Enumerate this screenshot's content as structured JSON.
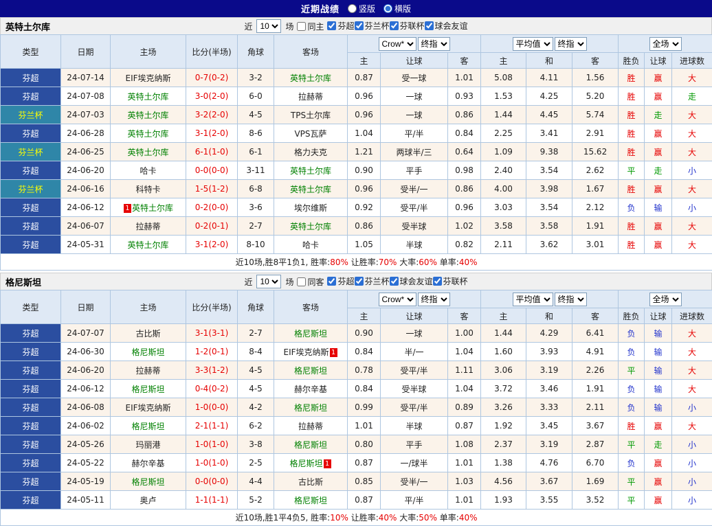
{
  "topbar": {
    "title": "近期战绩",
    "vertical_label": "竖版",
    "horizontal_label": "横版"
  },
  "ui": {
    "near_label": "近",
    "games_label": "场",
    "badge_text": "1",
    "cup_league": "芬兰杯"
  },
  "table": {
    "col_type": "类型",
    "col_date": "日期",
    "col_home": "主场",
    "col_score": "比分(半场)",
    "col_corner": "角球",
    "col_away": "客场",
    "bookmaker_select": "Crow*",
    "final_select_1": "终指",
    "average_select": "平均值",
    "final_select_2": "终指",
    "scope_select": "全场",
    "sub_headers": [
      "主",
      "让球",
      "客",
      "主",
      "和",
      "客",
      "胜负",
      "让球",
      "进球数"
    ]
  },
  "colors": {
    "topbar_bg": "#0a0a8a",
    "header_bg": "#dfe9f5",
    "border": "#aec6e0",
    "row_alt": "#fbf3ea",
    "super_bg": "#2b4ea0",
    "cup_bg": "#2f86a8",
    "cup_text": "#ffff00",
    "focus_team": "#008000",
    "score": "#e60000",
    "win": "#e60000",
    "draw": "#009900",
    "lose": "#2233cc"
  },
  "sections": [
    {
      "team": "英特土尔库",
      "filter": {
        "count": "10",
        "same_label": "同主",
        "leagues": [
          "芬超",
          "芬兰杯",
          "芬联杯",
          "球会友谊"
        ]
      },
      "rows": [
        {
          "lg": "芬超",
          "date": "24-07-14",
          "home": {
            "n": "EIF埃克纳斯"
          },
          "score": "0-7(0-2)",
          "cor": "3-2",
          "away": {
            "n": "英特土尔库",
            "f": 1
          },
          "o": [
            "0.87",
            "受一球",
            "1.01"
          ],
          "e": [
            "5.08",
            "4.11",
            "1.56"
          ],
          "r": [
            "胜",
            "赢",
            "大"
          ]
        },
        {
          "lg": "芬超",
          "date": "24-07-08",
          "home": {
            "n": "英特土尔库",
            "f": 1
          },
          "score": "3-0(2-0)",
          "cor": "6-0",
          "away": {
            "n": "拉赫蒂"
          },
          "o": [
            "0.96",
            "一球",
            "0.93"
          ],
          "e": [
            "1.53",
            "4.25",
            "5.20"
          ],
          "r": [
            "胜",
            "赢",
            "走"
          ]
        },
        {
          "lg": "芬兰杯",
          "date": "24-07-03",
          "home": {
            "n": "英特土尔库",
            "f": 1
          },
          "score": "3-2(2-0)",
          "cor": "4-5",
          "away": {
            "n": "TPS土尔库"
          },
          "o": [
            "0.96",
            "一球",
            "0.86"
          ],
          "e": [
            "1.44",
            "4.45",
            "5.74"
          ],
          "r": [
            "胜",
            "走",
            "大"
          ]
        },
        {
          "lg": "芬超",
          "date": "24-06-28",
          "home": {
            "n": "英特土尔库",
            "f": 1
          },
          "score": "3-1(2-0)",
          "cor": "8-6",
          "away": {
            "n": "VPS瓦萨"
          },
          "o": [
            "1.04",
            "平/半",
            "0.84"
          ],
          "e": [
            "2.25",
            "3.41",
            "2.91"
          ],
          "r": [
            "胜",
            "赢",
            "大"
          ]
        },
        {
          "lg": "芬兰杯",
          "date": "24-06-25",
          "home": {
            "n": "英特土尔库",
            "f": 1
          },
          "score": "6-1(1-0)",
          "cor": "6-1",
          "away": {
            "n": "格力夫克"
          },
          "o": [
            "1.21",
            "两球半/三",
            "0.64"
          ],
          "e": [
            "1.09",
            "9.38",
            "15.62"
          ],
          "r": [
            "胜",
            "赢",
            "大"
          ]
        },
        {
          "lg": "芬超",
          "date": "24-06-20",
          "home": {
            "n": "哈卡"
          },
          "score": "0-0(0-0)",
          "cor": "3-11",
          "away": {
            "n": "英特土尔库",
            "f": 1
          },
          "o": [
            "0.90",
            "平手",
            "0.98"
          ],
          "e": [
            "2.40",
            "3.54",
            "2.62"
          ],
          "r": [
            "平",
            "走",
            "小"
          ]
        },
        {
          "lg": "芬兰杯",
          "date": "24-06-16",
          "home": {
            "n": "科特卡"
          },
          "score": "1-5(1-2)",
          "cor": "6-8",
          "away": {
            "n": "英特土尔库",
            "f": 1
          },
          "o": [
            "0.96",
            "受半/一",
            "0.86"
          ],
          "e": [
            "4.00",
            "3.98",
            "1.67"
          ],
          "r": [
            "胜",
            "赢",
            "大"
          ]
        },
        {
          "lg": "芬超",
          "date": "24-06-12",
          "home": {
            "n": "英特土尔库",
            "f": 1,
            "b": "pre"
          },
          "score": "0-2(0-0)",
          "cor": "3-6",
          "away": {
            "n": "埃尔维斯"
          },
          "o": [
            "0.92",
            "受平/半",
            "0.96"
          ],
          "e": [
            "3.03",
            "3.54",
            "2.12"
          ],
          "r": [
            "负",
            "输",
            "小"
          ]
        },
        {
          "lg": "芬超",
          "date": "24-06-07",
          "home": {
            "n": "拉赫蒂"
          },
          "score": "0-2(0-1)",
          "cor": "2-7",
          "away": {
            "n": "英特土尔库",
            "f": 1
          },
          "o": [
            "0.86",
            "受半球",
            "1.02"
          ],
          "e": [
            "3.58",
            "3.58",
            "1.91"
          ],
          "r": [
            "胜",
            "赢",
            "大"
          ]
        },
        {
          "lg": "芬超",
          "date": "24-05-31",
          "home": {
            "n": "英特土尔库",
            "f": 1
          },
          "score": "3-1(2-0)",
          "cor": "8-10",
          "away": {
            "n": "哈卡"
          },
          "o": [
            "1.05",
            "半球",
            "0.82"
          ],
          "e": [
            "2.11",
            "3.62",
            "3.01"
          ],
          "r": [
            "胜",
            "赢",
            "大"
          ]
        }
      ],
      "footer": [
        {
          "t": "近10场,胜8平1负1,  胜率:"
        },
        {
          "t": "80%",
          "red": 1
        },
        {
          "t": "  让胜率:"
        },
        {
          "t": "70%",
          "red": 1
        },
        {
          "t": "  大率:"
        },
        {
          "t": "60%",
          "red": 1
        },
        {
          "t": "  单率:"
        },
        {
          "t": "40%",
          "red": 1
        }
      ]
    },
    {
      "team": "格尼斯坦",
      "filter": {
        "count": "10",
        "same_label": "同客",
        "leagues": [
          "芬超",
          "芬兰杯",
          "球会友谊",
          "芬联杯"
        ]
      },
      "rows": [
        {
          "lg": "芬超",
          "date": "24-07-07",
          "home": {
            "n": "古比斯"
          },
          "score": "3-1(3-1)",
          "cor": "2-7",
          "away": {
            "n": "格尼斯坦",
            "f": 1
          },
          "o": [
            "0.90",
            "一球",
            "1.00"
          ],
          "e": [
            "1.44",
            "4.29",
            "6.41"
          ],
          "r": [
            "负",
            "输",
            "大"
          ]
        },
        {
          "lg": "芬超",
          "date": "24-06-30",
          "home": {
            "n": "格尼斯坦",
            "f": 1
          },
          "score": "1-2(0-1)",
          "cor": "8-4",
          "away": {
            "n": "EIF埃克纳斯",
            "b": "post"
          },
          "o": [
            "0.84",
            "半/一",
            "1.04"
          ],
          "e": [
            "1.60",
            "3.93",
            "4.91"
          ],
          "r": [
            "负",
            "输",
            "大"
          ]
        },
        {
          "lg": "芬超",
          "date": "24-06-20",
          "home": {
            "n": "拉赫蒂"
          },
          "score": "3-3(1-2)",
          "cor": "4-5",
          "away": {
            "n": "格尼斯坦",
            "f": 1
          },
          "o": [
            "0.78",
            "受平/半",
            "1.11"
          ],
          "e": [
            "3.06",
            "3.19",
            "2.26"
          ],
          "r": [
            "平",
            "输",
            "大"
          ]
        },
        {
          "lg": "芬超",
          "date": "24-06-12",
          "home": {
            "n": "格尼斯坦",
            "f": 1
          },
          "score": "0-4(0-2)",
          "cor": "4-5",
          "away": {
            "n": "赫尔辛基"
          },
          "o": [
            "0.84",
            "受半球",
            "1.04"
          ],
          "e": [
            "3.72",
            "3.46",
            "1.91"
          ],
          "r": [
            "负",
            "输",
            "大"
          ]
        },
        {
          "lg": "芬超",
          "date": "24-06-08",
          "home": {
            "n": "EIF埃克纳斯"
          },
          "score": "1-0(0-0)",
          "cor": "4-2",
          "away": {
            "n": "格尼斯坦",
            "f": 1
          },
          "o": [
            "0.99",
            "受平/半",
            "0.89"
          ],
          "e": [
            "3.26",
            "3.33",
            "2.11"
          ],
          "r": [
            "负",
            "输",
            "小"
          ]
        },
        {
          "lg": "芬超",
          "date": "24-06-02",
          "home": {
            "n": "格尼斯坦",
            "f": 1
          },
          "score": "2-1(1-1)",
          "cor": "6-2",
          "away": {
            "n": "拉赫蒂"
          },
          "o": [
            "1.01",
            "半球",
            "0.87"
          ],
          "e": [
            "1.92",
            "3.45",
            "3.67"
          ],
          "r": [
            "胜",
            "赢",
            "大"
          ]
        },
        {
          "lg": "芬超",
          "date": "24-05-26",
          "home": {
            "n": "玛丽港"
          },
          "score": "1-0(1-0)",
          "cor": "3-8",
          "away": {
            "n": "格尼斯坦",
            "f": 1
          },
          "o": [
            "0.80",
            "平手",
            "1.08"
          ],
          "e": [
            "2.37",
            "3.19",
            "2.87"
          ],
          "r": [
            "平",
            "走",
            "小"
          ]
        },
        {
          "lg": "芬超",
          "date": "24-05-22",
          "home": {
            "n": "赫尔辛基"
          },
          "score": "1-0(1-0)",
          "cor": "2-5",
          "away": {
            "n": "格尼斯坦",
            "f": 1,
            "b": "post"
          },
          "o": [
            "0.87",
            "一/球半",
            "1.01"
          ],
          "e": [
            "1.38",
            "4.76",
            "6.70"
          ],
          "r": [
            "负",
            "赢",
            "小"
          ]
        },
        {
          "lg": "芬超",
          "date": "24-05-19",
          "home": {
            "n": "格尼斯坦",
            "f": 1
          },
          "score": "0-0(0-0)",
          "cor": "4-4",
          "away": {
            "n": "古比斯"
          },
          "o": [
            "0.85",
            "受半/一",
            "1.03"
          ],
          "e": [
            "4.56",
            "3.67",
            "1.69"
          ],
          "r": [
            "平",
            "赢",
            "小"
          ]
        },
        {
          "lg": "芬超",
          "date": "24-05-11",
          "home": {
            "n": "奥卢"
          },
          "score": "1-1(1-1)",
          "cor": "5-2",
          "away": {
            "n": "格尼斯坦",
            "f": 1
          },
          "o": [
            "0.87",
            "平/半",
            "1.01"
          ],
          "e": [
            "1.93",
            "3.55",
            "3.52"
          ],
          "r": [
            "平",
            "赢",
            "小"
          ]
        }
      ],
      "footer": [
        {
          "t": "近10场,胜1平4负5,  胜率:"
        },
        {
          "t": "10%",
          "red": 1
        },
        {
          "t": "  让胜率:"
        },
        {
          "t": "40%",
          "red": 1
        },
        {
          "t": "  大率:"
        },
        {
          "t": "50%",
          "red": 1
        },
        {
          "t": "  单率:"
        },
        {
          "t": "40%",
          "red": 1
        }
      ]
    }
  ]
}
